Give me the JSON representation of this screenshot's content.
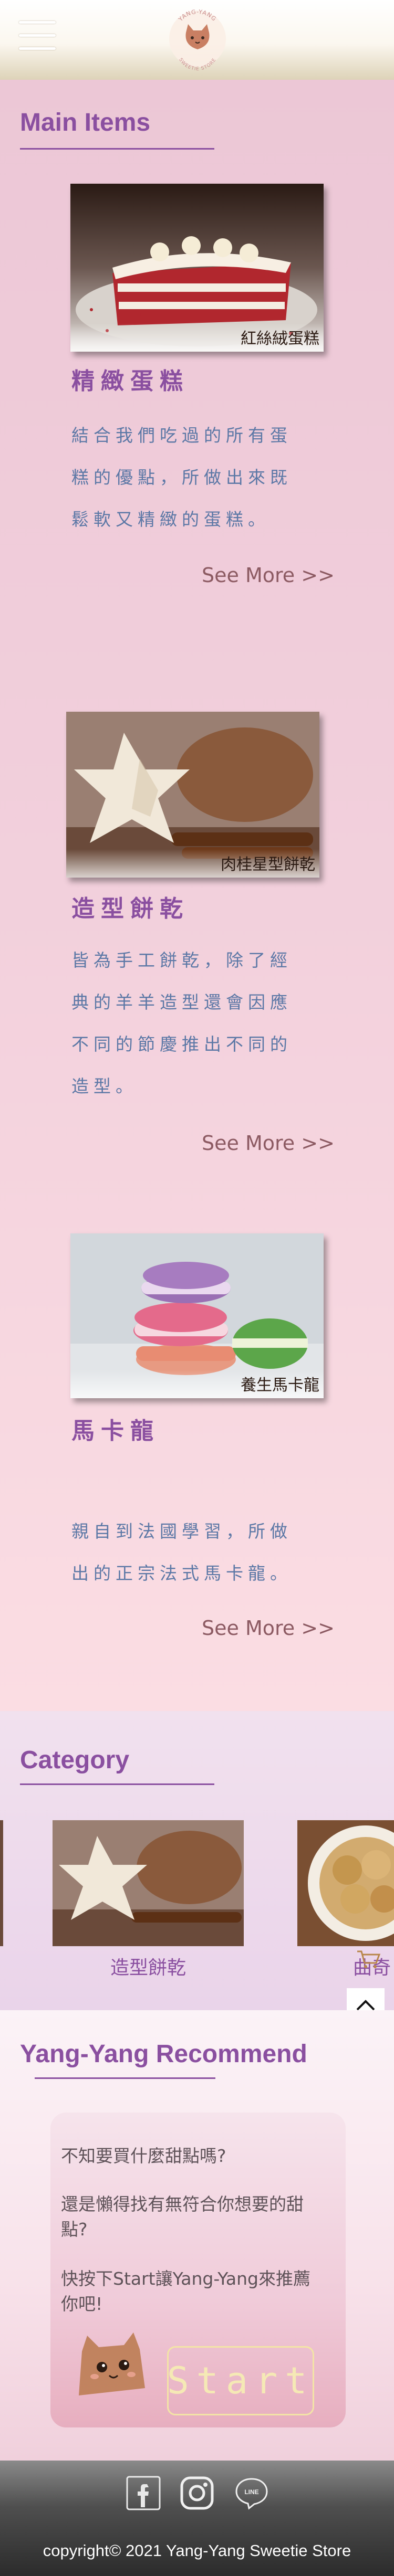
{
  "header": {
    "menu_icon": "hamburger-icon",
    "logo_top_text": "YANG-YANG",
    "logo_bottom_text": "SWEETIE STORE"
  },
  "main_items": {
    "title": "Main Items",
    "items": [
      {
        "caption": "紅絲絨蛋糕",
        "name": "精緻蛋糕",
        "desc_lines": [
          "結合我們吃過的所有蛋",
          "糕的優點，所做出來既",
          "鬆軟又精緻的蛋糕。"
        ],
        "see_more": "See More >>"
      },
      {
        "caption": "肉桂星型餅乾",
        "name": "造型餅乾",
        "desc_lines": [
          "皆為手工餅乾，除了經",
          "典的羊羊造型還會因應",
          "不同的節慶推出不同的",
          "造型。"
        ],
        "see_more": "See More >>"
      },
      {
        "caption": "養生馬卡龍",
        "name": "馬卡龍",
        "desc_lines": [
          "親自到法國學習，所做",
          "出的正宗法式馬卡龍。"
        ],
        "see_more": "See More >>"
      }
    ]
  },
  "category": {
    "title": "Category",
    "items": [
      {
        "label": "造型餅乾"
      },
      {
        "label": "曲奇"
      }
    ],
    "scroll_top_icon": "chevron-up-icon"
  },
  "recommend": {
    "title": "Yang-Yang Recommend",
    "line1": "不知要買什麼甜點嗎?",
    "line2a": "還是懶得找有無符合你想要的甜",
    "line2b": "點?",
    "line3a": "快按下Start讓Yang-Yang來推薦",
    "line3b": "你吧!",
    "start_label": "Start"
  },
  "footer": {
    "icons": [
      "facebook-icon",
      "instagram-icon",
      "line-icon"
    ],
    "line_text": "LINE",
    "copyright": "copyright© 2021 Yang-Yang Sweetie Store"
  },
  "colors": {
    "accent_purple": "#8a4fa0",
    "desc_blue": "#5c78a6",
    "see_more": "#8c5a62",
    "footer_dark": "#2b2b2b"
  }
}
